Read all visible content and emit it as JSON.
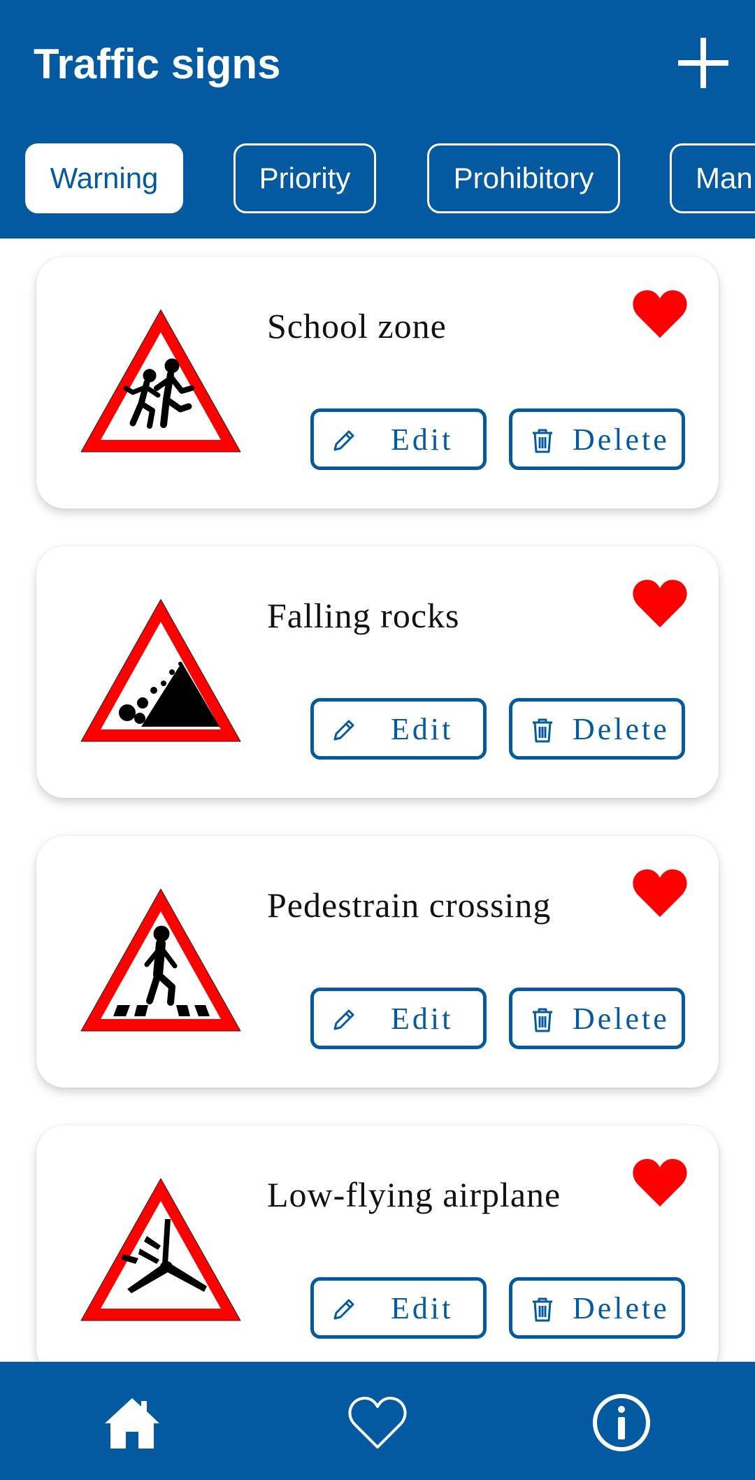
{
  "theme": {
    "brand": "#035aa0",
    "heart": "#ff0000",
    "sign_red": "#ff0000"
  },
  "header": {
    "title": "Traffic signs",
    "add_icon": "plus-icon"
  },
  "tabs": [
    {
      "label": "Warning",
      "selected": true
    },
    {
      "label": "Priority",
      "selected": false
    },
    {
      "label": "Prohibitory",
      "selected": false
    },
    {
      "label": "Man",
      "selected": false
    }
  ],
  "signs": [
    {
      "title": "School zone",
      "favorite": true,
      "edit_label": "Edit",
      "delete_label": "Delete",
      "icon": "school-zone-sign"
    },
    {
      "title": "Falling rocks",
      "favorite": true,
      "edit_label": "Edit",
      "delete_label": "Delete",
      "icon": "falling-rocks-sign"
    },
    {
      "title": "Pedestrain crossing",
      "favorite": true,
      "edit_label": "Edit",
      "delete_label": "Delete",
      "icon": "pedestrian-crossing-sign"
    },
    {
      "title": "Low-flying airplane",
      "favorite": true,
      "edit_label": "Edit",
      "delete_label": "Delete",
      "icon": "low-flying-airplane-sign"
    }
  ],
  "bottom_nav": [
    {
      "icon": "home-icon",
      "active": true
    },
    {
      "icon": "heart-outline-icon",
      "active": false
    },
    {
      "icon": "info-icon",
      "active": false
    }
  ]
}
